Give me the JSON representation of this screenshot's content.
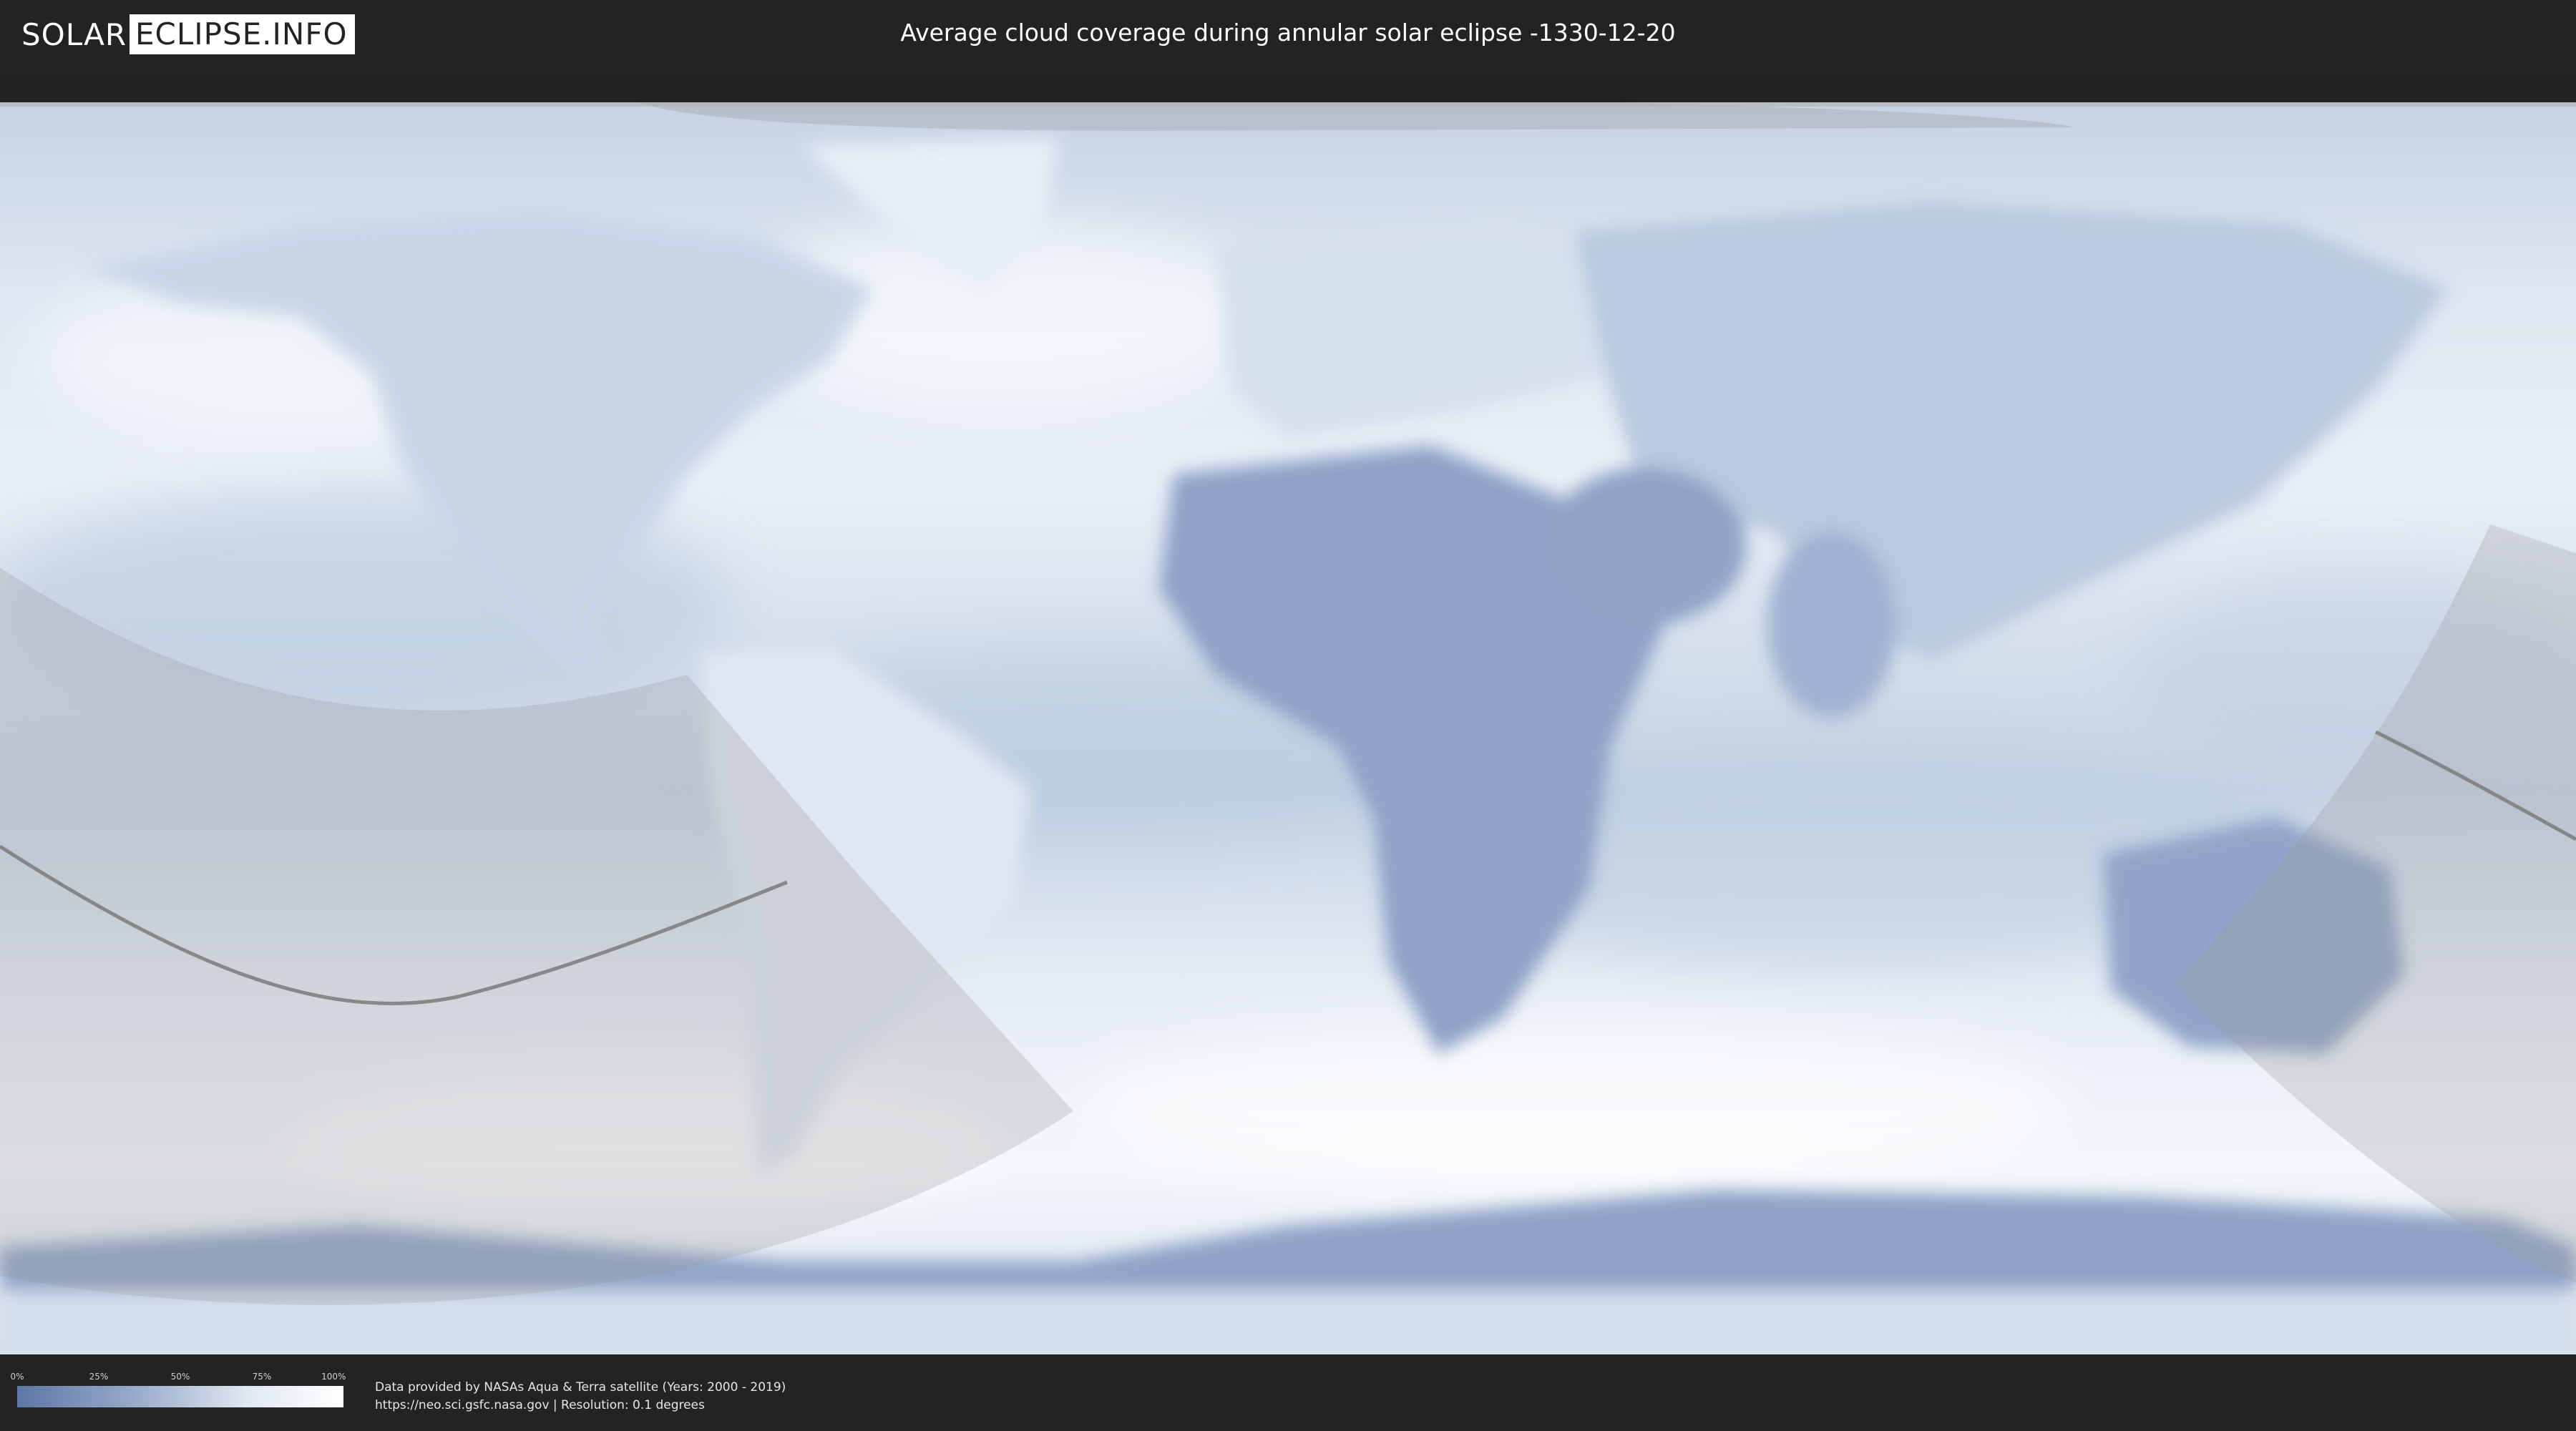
{
  "logo": {
    "part1": "SOLAR",
    "part2": "ECLIPSE.INFO"
  },
  "title": "Average cloud coverage during annular solar eclipse -1330-12-20",
  "legend": {
    "ticks": [
      "0%",
      "25%",
      "50%",
      "75%",
      "100%"
    ]
  },
  "credits": {
    "line1": "Data provided by NASAs Aqua & Terra satellite (Years: 2000 - 2019)",
    "line2": "https://neo.sci.gsfc.nasa.gov | Resolution: 0.1 degrees"
  },
  "colors": {
    "clear_sky": "#5d77a6",
    "full_cloud": "#ffffff",
    "header_bg": "#232323",
    "eclipse_shadow": "#9a9a9a",
    "eclipse_path": "#7a7a7a"
  }
}
